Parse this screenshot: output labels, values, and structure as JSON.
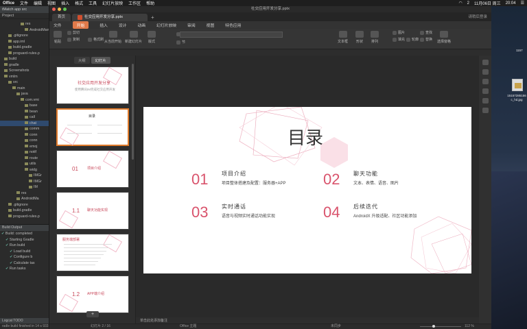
{
  "menubar": {
    "app": "Office",
    "items": [
      "文件",
      "编辑",
      "视图",
      "插入",
      "格式",
      "工具",
      "幻灯片放映",
      "工作区",
      "帮助"
    ],
    "status_right": [
      "2",
      "11月06日 周三",
      "20:04"
    ]
  },
  "ide": {
    "top": "tMatch  app  src",
    "project_label": "Project",
    "tree": [
      {
        "label": "res",
        "indent": 5
      },
      {
        "label": "AndroidMan",
        "indent": 6
      },
      {
        "label": ".gitignore",
        "indent": 2
      },
      {
        "label": "app.iml",
        "indent": 2
      },
      {
        "label": "build.gradle",
        "indent": 2
      },
      {
        "label": "proguard-rules.p",
        "indent": 2
      },
      {
        "label": "build",
        "indent": 1
      },
      {
        "label": "gradle",
        "indent": 1
      },
      {
        "label": "Screenshots",
        "indent": 1
      },
      {
        "label": "vmlm",
        "indent": 1
      },
      {
        "label": "src",
        "indent": 2
      },
      {
        "label": "main",
        "indent": 3
      },
      {
        "label": "java",
        "indent": 4
      },
      {
        "label": "com.vmi",
        "indent": 5
      },
      {
        "label": "base",
        "indent": 6
      },
      {
        "label": "bean",
        "indent": 6
      },
      {
        "label": "call",
        "indent": 6
      },
      {
        "label": "chat",
        "indent": 6
      },
      {
        "label": "comm",
        "indent": 6
      },
      {
        "label": "conn",
        "indent": 6
      },
      {
        "label": "conn",
        "indent": 6
      },
      {
        "label": "emoj",
        "indent": 6
      },
      {
        "label": "notif",
        "indent": 6
      },
      {
        "label": "route",
        "indent": 6
      },
      {
        "label": "utils",
        "indent": 6
      },
      {
        "label": "widg",
        "indent": 6
      },
      {
        "label": "IMGr",
        "indent": 7
      },
      {
        "label": "IMGr",
        "indent": 7
      },
      {
        "label": "IM",
        "indent": 7
      },
      {
        "label": "res",
        "indent": 4
      },
      {
        "label": "AndroidMa",
        "indent": 4
      },
      {
        "label": ".gitignore",
        "indent": 2
      },
      {
        "label": "build.gradle",
        "indent": 2
      },
      {
        "label": "proguard-rules.p",
        "indent": 2
      }
    ],
    "build_header": "Build Output",
    "build_rows": [
      "Build: completed",
      "Starting Gradle",
      "Run build",
      "Load build",
      "Configure b",
      "Calculate tas",
      "Run tasks"
    ],
    "bottom_tabs": "Logcat   TODO",
    "status": "radle build finished in 14 s 933"
  },
  "wps": {
    "window_title": "社交应用开发分享.pptx",
    "tabs": {
      "home": "首页",
      "doc": "社交应用开发分享.pptx",
      "right": "请稍后登录"
    },
    "ribbon_menu": [
      "文件",
      "开始",
      "插入",
      "设计",
      "动画",
      "幻灯片放映",
      "审阅",
      "视图",
      "特色应用"
    ],
    "active_menu": "开始",
    "toolbar_labels": [
      "粘贴",
      "剪切",
      "复制",
      "格式刷",
      "从当前开始",
      "新建幻灯片",
      "版式",
      "重置",
      "节",
      "文本框",
      "形状",
      "排列",
      "图片",
      "填充",
      "轮廓",
      "查找",
      "替换",
      "选择窗格"
    ],
    "thumb_tabs": [
      "大纲",
      "幻灯片"
    ],
    "thumbnails": [
      {
        "title": "社交应用开发分享",
        "sub": "使用腾讯IM完成社交应用开发"
      },
      {
        "title": "目录",
        "sub": ""
      },
      {
        "title": "项目介绍",
        "sub": "01"
      },
      {
        "title": "聊天功能实现",
        "sub": "1.1"
      },
      {
        "title": "服务端部署",
        "sub": ""
      },
      {
        "title": "APP端介绍",
        "sub": "1.2"
      }
    ],
    "add_label": "+",
    "slide": {
      "title": "目录",
      "items": [
        {
          "num": "01",
          "head": "项目介绍",
          "desc": "项目整体搭建及配置：服务器+APP"
        },
        {
          "num": "02",
          "head": "聊天功能",
          "desc": "文本、表情、语音、图片"
        },
        {
          "num": "03",
          "head": "实时通话",
          "desc": "语音与视频实时通话功能实现"
        },
        {
          "num": "04",
          "head": "后续迭代",
          "desc": "AndroidX 升级适配、社区功能添加"
        }
      ],
      "accent_color": "#d9536c"
    },
    "notes_placeholder": "单击此处添加备注",
    "status": {
      "slide_count": "幻灯片 2 / 16",
      "theme": "Office 主题",
      "backup": "未同步",
      "zoom": "112 %"
    }
  },
  "desktop": {
    "file_label": "15157285156 c_hd.jpg",
    "partial_label": "1157"
  }
}
